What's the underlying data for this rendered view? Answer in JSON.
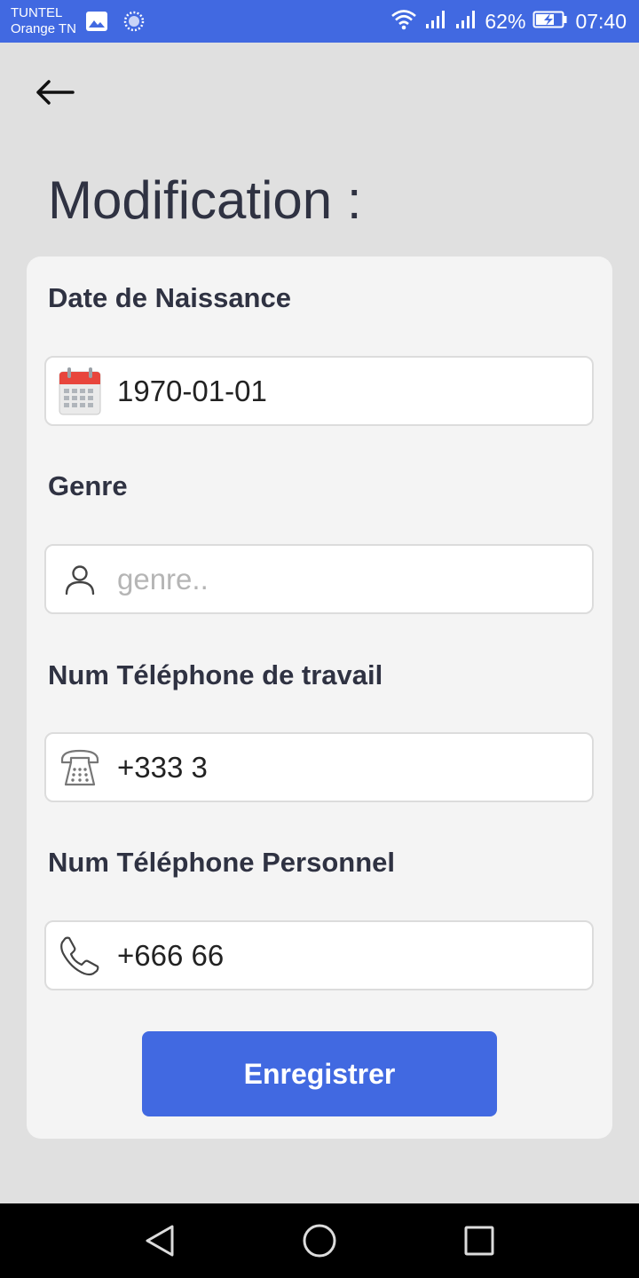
{
  "status_bar": {
    "carrier_line1": "TUNTEL",
    "carrier_line2": "Orange TN",
    "battery_percent": "62%",
    "time": "07:40",
    "icons": [
      "gallery-icon",
      "loading-icon",
      "wifi-icon",
      "signal-icon",
      "signal-icon",
      "battery-charging-icon"
    ]
  },
  "header": {
    "back_icon": "arrow-left-icon",
    "title": "Modification :"
  },
  "form": {
    "birth_date": {
      "label": "Date de Naissance",
      "value": "1970-01-01",
      "icon": "calendar-icon"
    },
    "gender": {
      "label": "Genre",
      "value": "",
      "placeholder": "genre..",
      "icon": "person-icon"
    },
    "work_phone": {
      "label": "Num Téléphone de travail",
      "value": "+333 3",
      "icon": "desk-phone-icon"
    },
    "personal_phone": {
      "label": "Num Téléphone Personnel",
      "value": "+666 66",
      "icon": "phone-icon"
    },
    "save_label": "Enregistrer"
  },
  "nav_bar": {
    "icons": [
      "back-triangle-icon",
      "home-circle-icon",
      "recents-square-icon"
    ]
  },
  "colors": {
    "accent": "#4169e1",
    "background": "#e0e0e0",
    "card": "#f4f4f4",
    "text_dark": "#2f3242",
    "calendar_red": "#e8453c"
  }
}
